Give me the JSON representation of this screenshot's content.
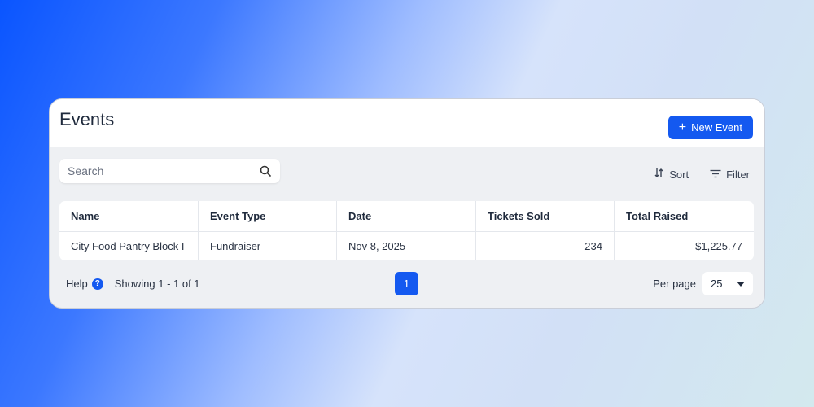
{
  "header": {
    "title": "Events",
    "new_button_label": "New Event"
  },
  "search": {
    "placeholder": "Search",
    "value": ""
  },
  "toolbar": {
    "sort_label": "Sort",
    "filter_label": "Filter"
  },
  "table": {
    "columns": [
      "Name",
      "Event Type",
      "Date",
      "Tickets Sold",
      "Total Raised"
    ],
    "rows": [
      [
        "City Food Pantry Block I",
        "Fundraiser",
        "Nov 8, 2025",
        "234",
        "$1,225.77"
      ]
    ]
  },
  "footer": {
    "help_label": "Help",
    "showing_text": "Showing 1 - 1 of 1",
    "current_page": "1",
    "per_page_label": "Per page",
    "per_page_value": "25"
  },
  "colors": {
    "accent": "#1459f0"
  }
}
